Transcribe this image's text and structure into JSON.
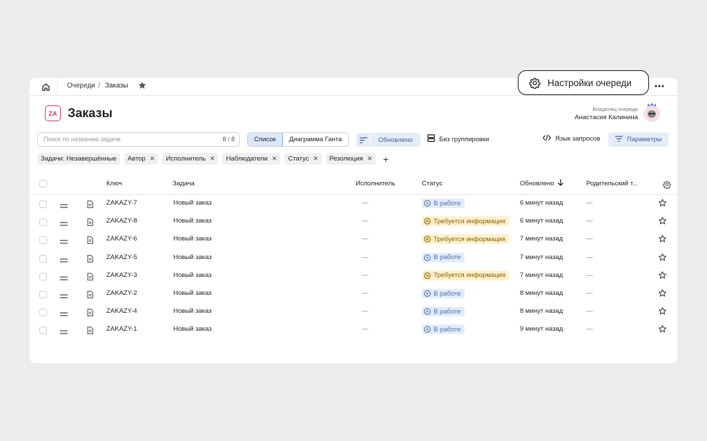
{
  "breadcrumb": {
    "items": [
      "Очереди",
      "Заказы"
    ],
    "separator": "/"
  },
  "top_actions": {
    "settings_label": "Настройки очереди",
    "more_icon": "ellipsis-icon"
  },
  "queue": {
    "logo_text": "ZA",
    "title": "Заказы",
    "owner_caption": "Владелец очереди",
    "owner_name": "Анастасия Калинина"
  },
  "toolbar": {
    "search_placeholder": "Поиск по названию задачи",
    "search_counter": "8 / 8",
    "views": [
      "Список",
      "Диаграмма Ганта"
    ],
    "active_view": "Список",
    "sort_label": "Обновлено",
    "group_label": "Без группировки",
    "query_label": "Язык запросов",
    "params_label": "Параметры"
  },
  "filters": [
    "Задачи: Незавершённые",
    "Автор",
    "Исполнитель",
    "Наблюдатели",
    "Статус",
    "Резолюция"
  ],
  "filters_removable": [
    false,
    true,
    true,
    true,
    true,
    true
  ],
  "table": {
    "columns": [
      "Ключ",
      "Задача",
      "Исполнитель",
      "Статус",
      "Обновлено",
      "Родительский т..."
    ],
    "rows": [
      {
        "key": "ZAKAZY-7",
        "task": "Новый заказ",
        "assignee": "—",
        "status": "В работе",
        "status_type": "work",
        "updated": "6 минут назад",
        "parent": "—"
      },
      {
        "key": "ZAKAZY-8",
        "task": "Новый заказ",
        "assignee": "—",
        "status": "Требуется информация",
        "status_type": "info",
        "updated": "6 минут назад",
        "parent": "—"
      },
      {
        "key": "ZAKAZY-6",
        "task": "Новый заказ",
        "assignee": "—",
        "status": "Требуется информация",
        "status_type": "info",
        "updated": "7 минут назад",
        "parent": "—"
      },
      {
        "key": "ZAKAZY-5",
        "task": "Новый заказ",
        "assignee": "—",
        "status": "В работе",
        "status_type": "work",
        "updated": "7 минут назад",
        "parent": "—"
      },
      {
        "key": "ZAKAZY-3",
        "task": "Новый заказ",
        "assignee": "—",
        "status": "Требуется информация",
        "status_type": "info",
        "updated": "7 минут назад",
        "parent": "—"
      },
      {
        "key": "ZAKAZY-2",
        "task": "Новый заказ",
        "assignee": "—",
        "status": "В работе",
        "status_type": "work",
        "updated": "8 минут назад",
        "parent": "—"
      },
      {
        "key": "ZAKAZY-4",
        "task": "Новый заказ",
        "assignee": "—",
        "status": "В работе",
        "status_type": "work",
        "updated": "8 минут назад",
        "parent": "—"
      },
      {
        "key": "ZAKAZY-1",
        "task": "Новый заказ",
        "assignee": "—",
        "status": "В работе",
        "status_type": "work",
        "updated": "9 минут назад",
        "parent": "—"
      }
    ]
  },
  "colors": {
    "brand": "#d1365a",
    "accent": "#e4ecfa",
    "status_work": "#4a6fb3",
    "status_info": "#fff0cc"
  }
}
